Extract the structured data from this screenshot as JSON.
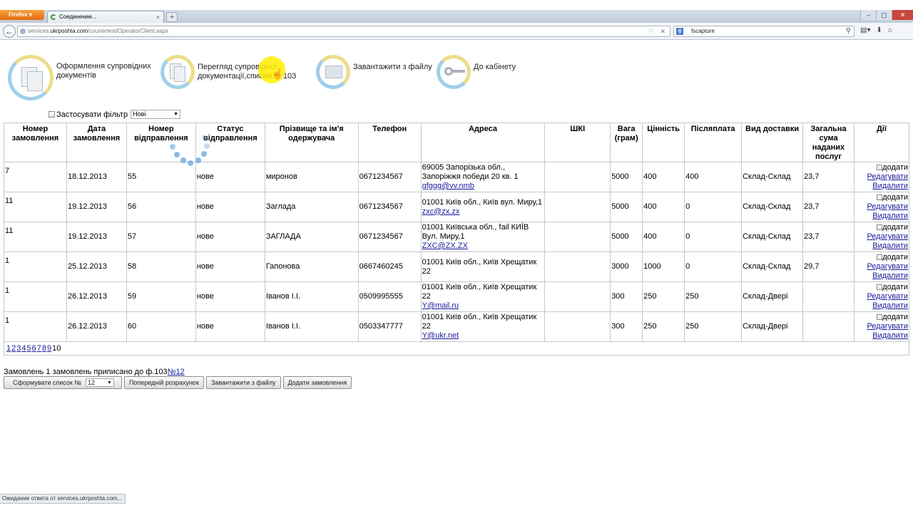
{
  "browser": {
    "app_button": "Firefox",
    "tab_title": "Соединение...",
    "url_prefix": "services.",
    "url_domain": "ukrposhta.com",
    "url_path": "/couriertest/OperatorClient.aspx",
    "search_value": "fscapture",
    "status_text": "Ожидание ответа от services.ukrposhta.com..."
  },
  "menu": {
    "create_docs": "Оформлення супровідних документів",
    "view_docs_line1": "Перегляд супровідної",
    "view_docs_line2": "документації,списків ф 103",
    "upload": "Завантажити з файлу",
    "cabinet": "До кабінету"
  },
  "filter": {
    "label": "Застосувати фільтр",
    "selected": "Нові"
  },
  "table": {
    "headers": [
      "Номер замовлення",
      "Дата замовлення",
      "Номер відправлення",
      "Статус відправлення",
      "Прізвище та ім'я одержувача",
      "Телефон",
      "Адреса",
      "ШКІ",
      "Вага (грам)",
      "Цінність",
      "Післяплата",
      "Вид доставки",
      "Загальна сума наданих послуг",
      "Дії"
    ],
    "rows": [
      {
        "order": "7",
        "date": "18.12.2013",
        "shipment": "55",
        "status": "нове",
        "name": "миронов",
        "phone": "0671234567",
        "address": "69005 Запорізька обл., Запоріжжя победи 20 кв. 1",
        "email": "gfggg@vv.nmb",
        "shki": "",
        "weight": "5000",
        "value": "400",
        "cod": "400",
        "delivery": "Склад-Склад",
        "total": "23,7"
      },
      {
        "order": "11",
        "date": "19.12.2013",
        "shipment": "56",
        "status": "нове",
        "name": "Заглада",
        "phone": "0671234567",
        "address": "01001 Київ обл., Київ вул. Миру,1",
        "email": "zxc@zx.zx",
        "shki": "",
        "weight": "5000",
        "value": "400",
        "cod": "0",
        "delivery": "Склад-Склад",
        "total": "23,7"
      },
      {
        "order": "11",
        "date": "19.12.2013",
        "shipment": "57",
        "status": "нове",
        "name": "ЗАГЛАДА",
        "phone": "0671234567",
        "address": "01001 Київська обл., fail КИЇВ Вул. Миру,1",
        "email": "ZXC@ZX.ZX",
        "shki": "",
        "weight": "5000",
        "value": "400",
        "cod": "0",
        "delivery": "Склад-Склад",
        "total": "23,7"
      },
      {
        "order": "1",
        "date": "25.12.2013",
        "shipment": "58",
        "status": "нове",
        "name": "Гапонова",
        "phone": "0667460245",
        "address": "01001 Київ обл., Київ Хрещатик 22",
        "email": "",
        "shki": "",
        "weight": "3000",
        "value": "1000",
        "cod": "0",
        "delivery": "Склад-Склад",
        "total": "29,7"
      },
      {
        "order": "1",
        "date": "26.12.2013",
        "shipment": "59",
        "status": "нове",
        "name": "Іванов І.І.",
        "phone": "0509995555",
        "address": "01001 Київ обл., Київ Хрещатик 22",
        "email": "Y@mail.ru",
        "shki": "",
        "weight": "300",
        "value": "250",
        "cod": "250",
        "delivery": "Склад-Двері",
        "total": ""
      },
      {
        "order": "1",
        "date": "26.12.2013",
        "shipment": "60",
        "status": "нове",
        "name": "Іванов І.І.",
        "phone": "0503347777",
        "address": "01001 Київ обл., Київ Хрещатик 22",
        "email": "Y@ukr.net",
        "shki": "",
        "weight": "300",
        "value": "250",
        "cod": "250",
        "delivery": "Склад-Двері",
        "total": ""
      }
    ],
    "actions": {
      "add": "додати",
      "edit": "Редагувати",
      "delete": "Видалити"
    }
  },
  "pager": {
    "pages": [
      "1",
      "2",
      "3",
      "4",
      "5",
      "6",
      "7",
      "8",
      "9"
    ],
    "current": "10"
  },
  "summary": {
    "text": "Замовлень 1 замовлень приписано до ф.103",
    "link": "№12"
  },
  "buttons": {
    "form_list": "Сформувати список №",
    "form_list_value": "12",
    "preliminary": "Попередній розрахунок",
    "upload": "Завантажити з файлу",
    "add_order": "Додати замовлення"
  }
}
